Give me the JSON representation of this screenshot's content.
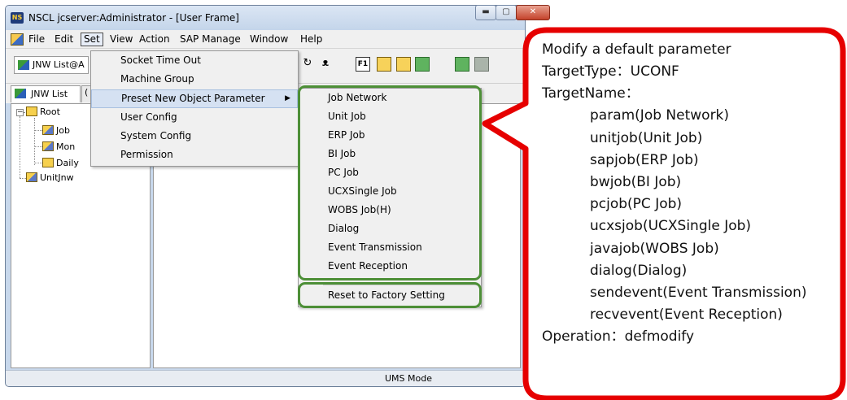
{
  "window": {
    "logo_text": "NS",
    "title": "NSCL jcserver:Administrator - [User Frame]",
    "buttons": {
      "minimize": "▬",
      "maximize": "▢",
      "close": "✕"
    }
  },
  "menubar": {
    "items": [
      "File",
      "Edit",
      "Set",
      "View",
      "Action",
      "SAP Manage",
      "Window",
      "Help"
    ],
    "active": "Set"
  },
  "toolbar": {
    "combo_label": "JNW List@A",
    "box_icon_label": "F1"
  },
  "tabs": {
    "jnw_list": "JNW List",
    "second_tab_partial": "("
  },
  "tree": {
    "root": "Root",
    "children": [
      "Job",
      "Mon",
      "Daily"
    ],
    "sibling": "UnitJnw"
  },
  "set_menu": {
    "items": [
      {
        "label": "Socket Time Out"
      },
      {
        "label": "Machine Group"
      },
      {
        "label": "Preset New Object Parameter",
        "has_submenu": true,
        "highlighted": true
      },
      {
        "label": "User Config"
      },
      {
        "label": "System Config"
      },
      {
        "label": "Permission"
      }
    ]
  },
  "submenu": {
    "items": [
      "Job Network",
      "Unit Job",
      "ERP Job",
      "BI Job",
      "PC Job",
      "UCXSingle Job",
      "WOBS Job(H)",
      "Dialog",
      "Event Transmission",
      "Event Reception"
    ],
    "reset_label": "Reset to Factory Setting"
  },
  "status": {
    "mode": "UMS Mode"
  },
  "callout": {
    "lines": [
      "Modify a default parameter",
      "TargetType：UCONF",
      "TargetName：",
      "param(Job Network)",
      "unitjob(Unit Job)",
      "sapjob(ERP Job)",
      "bwjob(BI Job)",
      "pcjob(PC Job)",
      "ucxsjob(UCXSingle Job)",
      "javajob(WOBS Job)",
      "dialog(Dialog)",
      "sendevent(Event Transmission)",
      "recvevent(Event Reception)",
      "Operation：defmodify"
    ]
  },
  "colors": {
    "callout_border": "#e60000",
    "highlight_green": "#4d8f37",
    "menu_highlight": "#d5e1f2"
  }
}
